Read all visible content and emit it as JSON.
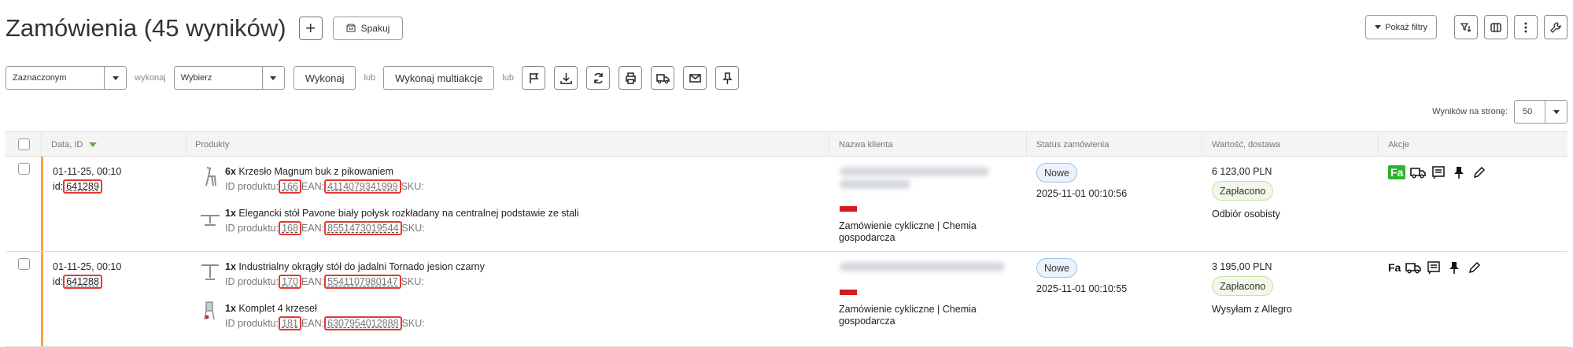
{
  "header": {
    "title": "Zamówienia (45 wyników)",
    "add_label": "+",
    "pack_label": "Spakuj",
    "show_filters_label": "Pokaż filtry"
  },
  "toolbar": {
    "scope_select": "Zaznaczonym",
    "do_label": "wykonaj",
    "action_select": "Wybierz",
    "execute_label": "Wykonaj",
    "or1": "lub",
    "multi_label": "Wykonaj multiakcje",
    "or2": "lub"
  },
  "pagination": {
    "per_page_label": "Wyników na stronę:",
    "per_page_value": "50"
  },
  "table": {
    "columns": [
      "Data, ID",
      "Produkty",
      "Nazwa klienta",
      "Status zamówienia",
      "Wartość, dostawa",
      "Akcje"
    ],
    "rows": [
      {
        "date": "01-11-25, 00:10",
        "id_label": "id:",
        "id": "641289",
        "products": [
          {
            "qty": "6x",
            "name": "Krzesło Magnum buk z pikowaniem",
            "id_label": "ID produktu:",
            "product_id": "166",
            "ean_label": "EAN:",
            "ean": "4114079341999",
            "sku_label": "SKU:"
          },
          {
            "qty": "1x",
            "name": "Elegancki stół Pavone biały połysk rozkładany na centralnej podstawie ze stali",
            "id_label": "ID produktu:",
            "product_id": "168",
            "ean_label": "EAN:",
            "ean": "8551473019544",
            "sku_label": "SKU:"
          }
        ],
        "client_note": "Zamówienie cykliczne | Chemia gospodarcza",
        "status": "Nowe",
        "status_time": "2025-11-01 00:10:56",
        "value": "6 123,00 PLN",
        "payment": "Zapłacono",
        "delivery": "Odbiór osobisty",
        "invoice": "Fa",
        "invoice_color": "#2db42d"
      },
      {
        "date": "01-11-25, 00:10",
        "id_label": "id:",
        "id": "641288",
        "products": [
          {
            "qty": "1x",
            "name": "Industrialny okrągły stół do jadalni Tornado jesion czarny",
            "id_label": "ID produktu:",
            "product_id": "170",
            "ean_label": "EAN:",
            "ean": "5541107980147",
            "sku_label": "SKU:"
          },
          {
            "qty": "1x",
            "name": "Komplet 4 krzeseł",
            "id_label": "ID produktu:",
            "product_id": "181",
            "ean_label": "EAN:",
            "ean": "6307954012888",
            "sku_label": "SKU:"
          }
        ],
        "client_note": "Zamówienie cykliczne | Chemia gospodarcza",
        "status": "Nowe",
        "status_time": "2025-11-01 00:10:55",
        "value": "3 195,00 PLN",
        "payment": "Zapłacono",
        "delivery": "Wysyłam z Allegro",
        "invoice": "Fa",
        "invoice_color": "#111111"
      }
    ]
  },
  "colors": {
    "accent_orange": "#f7a54a",
    "highlight_red": "#e53935",
    "flag_red": "#d71920",
    "sort_green": "#6aa84f"
  }
}
